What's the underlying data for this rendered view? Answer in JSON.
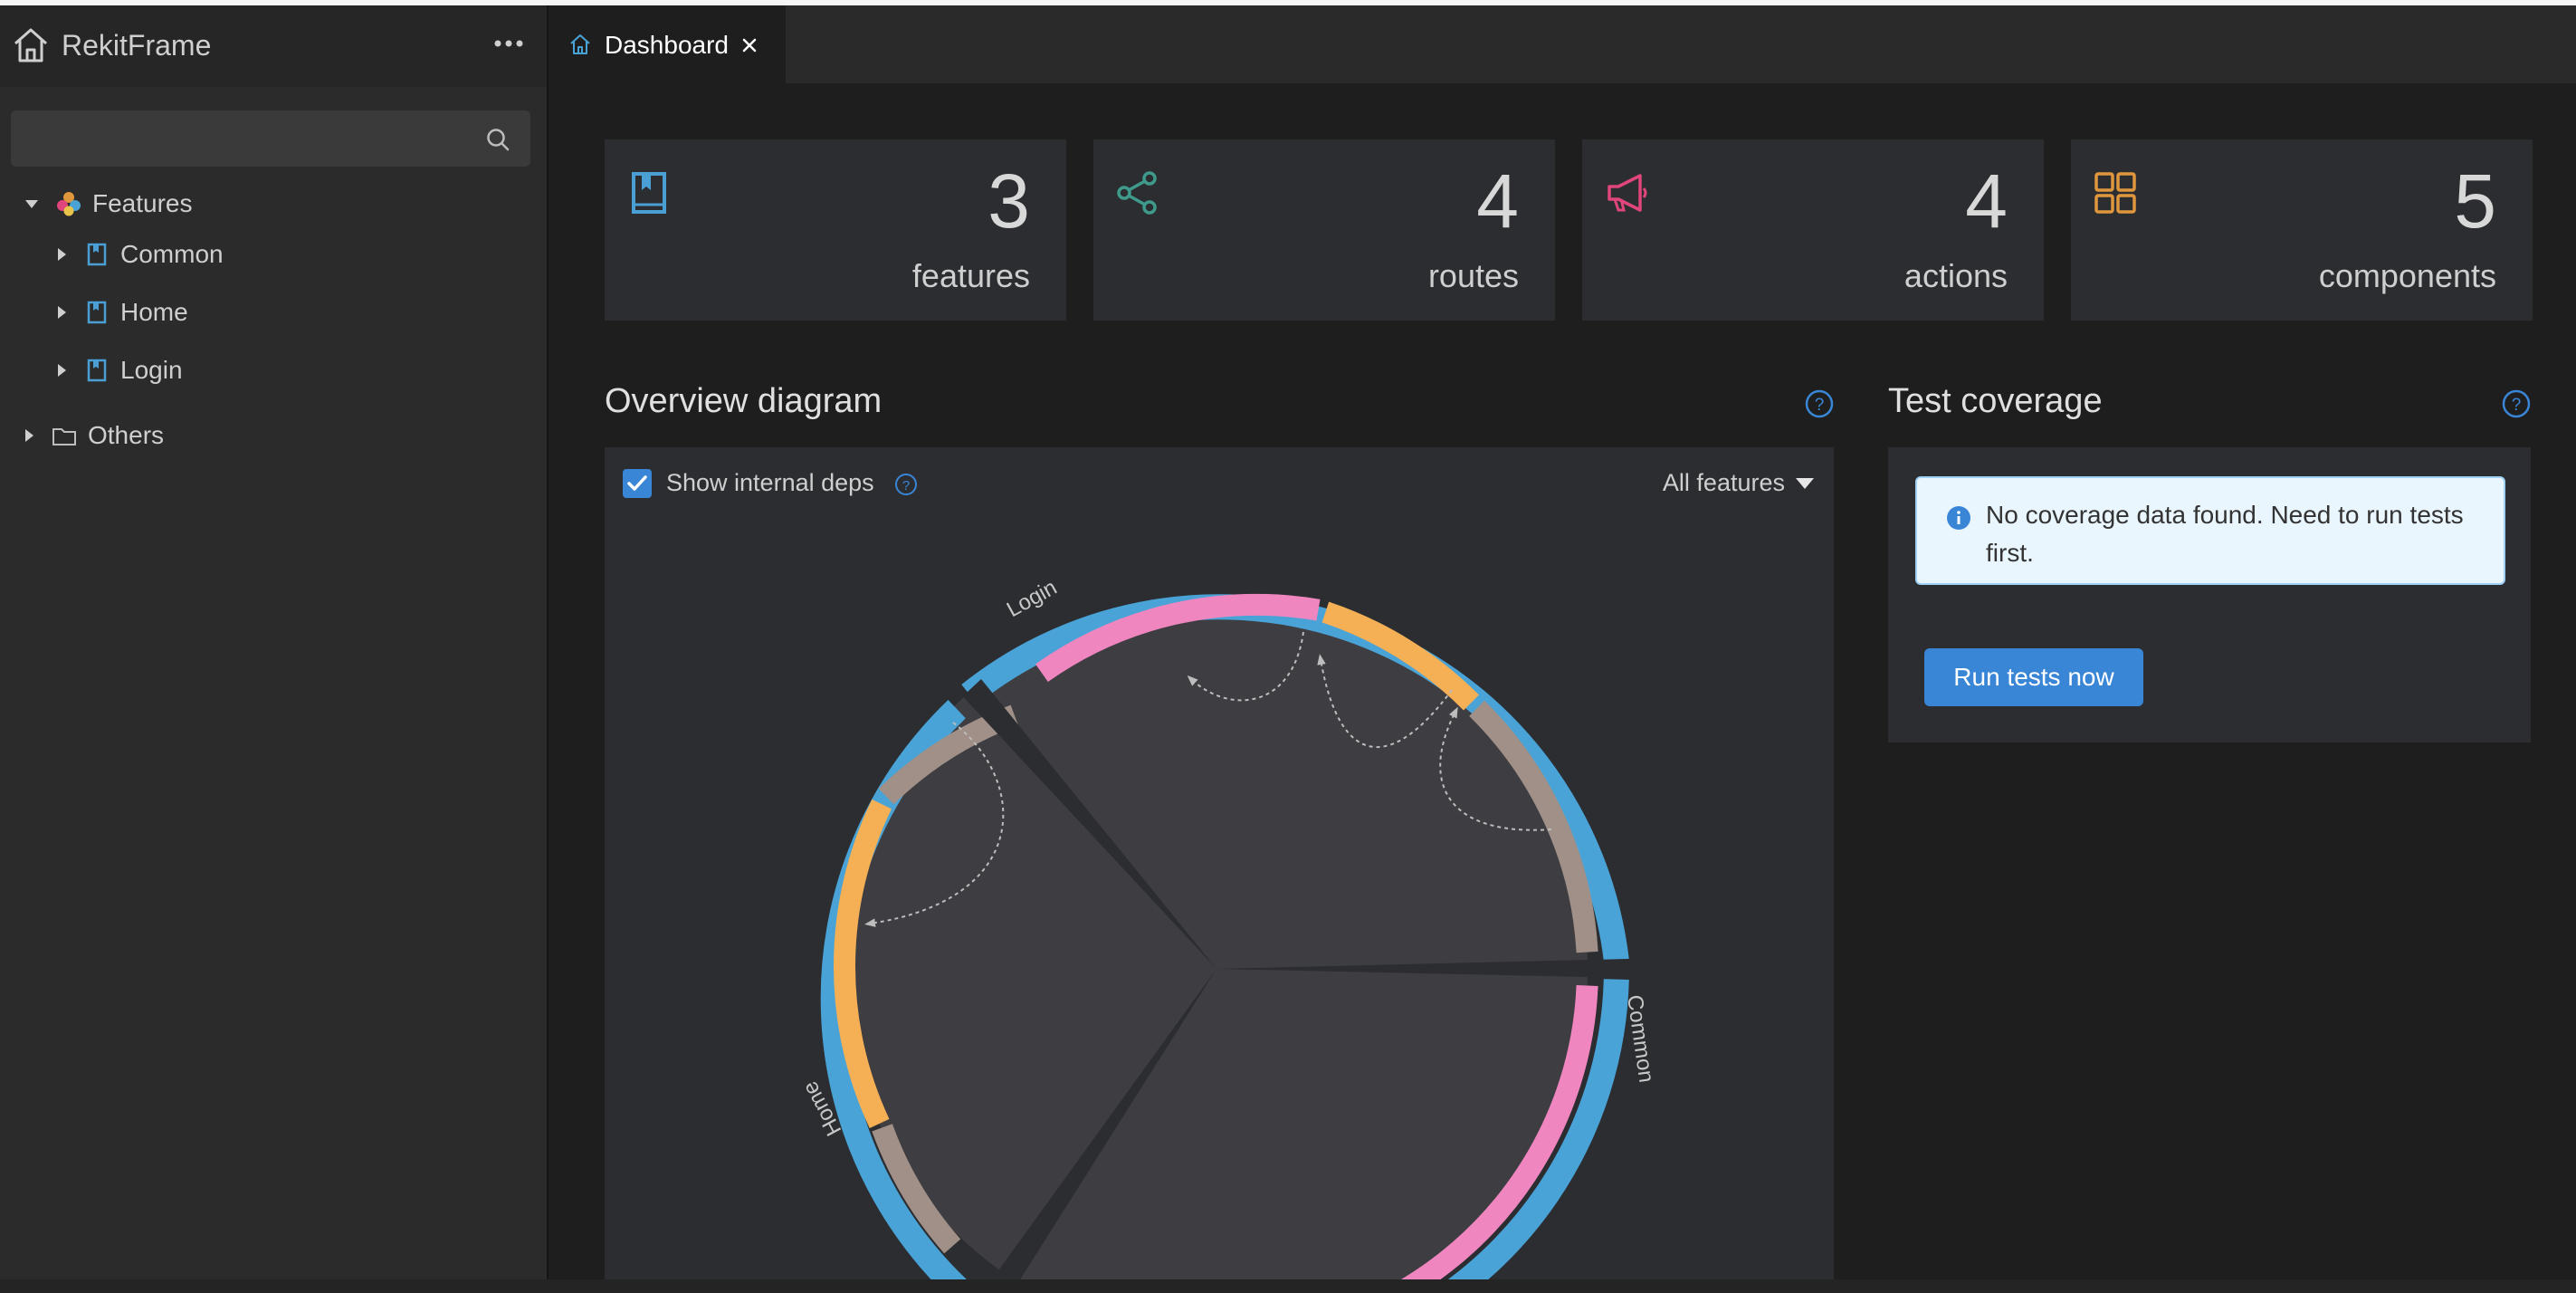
{
  "app": {
    "name": "RekitFrame"
  },
  "sidebar": {
    "search": {
      "placeholder": ""
    },
    "tree": {
      "features_label": "Features",
      "feature_items": [
        {
          "label": "Common"
        },
        {
          "label": "Home"
        },
        {
          "label": "Login"
        }
      ],
      "others_label": "Others"
    }
  },
  "tabs": [
    {
      "label": "Dashboard",
      "icon": "home-icon",
      "active": true
    }
  ],
  "stats": [
    {
      "value": "3",
      "label": "features",
      "icon": "book-icon",
      "color": "#4a9fd5"
    },
    {
      "value": "4",
      "label": "routes",
      "icon": "share-icon",
      "color": "#3f9a8c"
    },
    {
      "value": "4",
      "label": "actions",
      "icon": "megaphone-icon",
      "color": "#e0457b"
    },
    {
      "value": "5",
      "label": "components",
      "icon": "appstore-icon",
      "color": "#e0963c"
    }
  ],
  "overview": {
    "title": "Overview diagram",
    "show_internal_deps": {
      "label": "Show internal deps",
      "checked": true
    },
    "filter": {
      "selected": "All features"
    },
    "diagram_labels": {
      "login": "Login",
      "common": "Common",
      "home": "Home"
    }
  },
  "coverage": {
    "title": "Test coverage",
    "alert": "No coverage data found. Need to run tests first.",
    "run_button": "Run tests now"
  },
  "colors": {
    "accent": "#3a86d6",
    "feature_ring": "#4aa3d6",
    "action_segment": "#f086c0",
    "component_segment": "#f5b055",
    "misc_segment": "#a09088"
  }
}
